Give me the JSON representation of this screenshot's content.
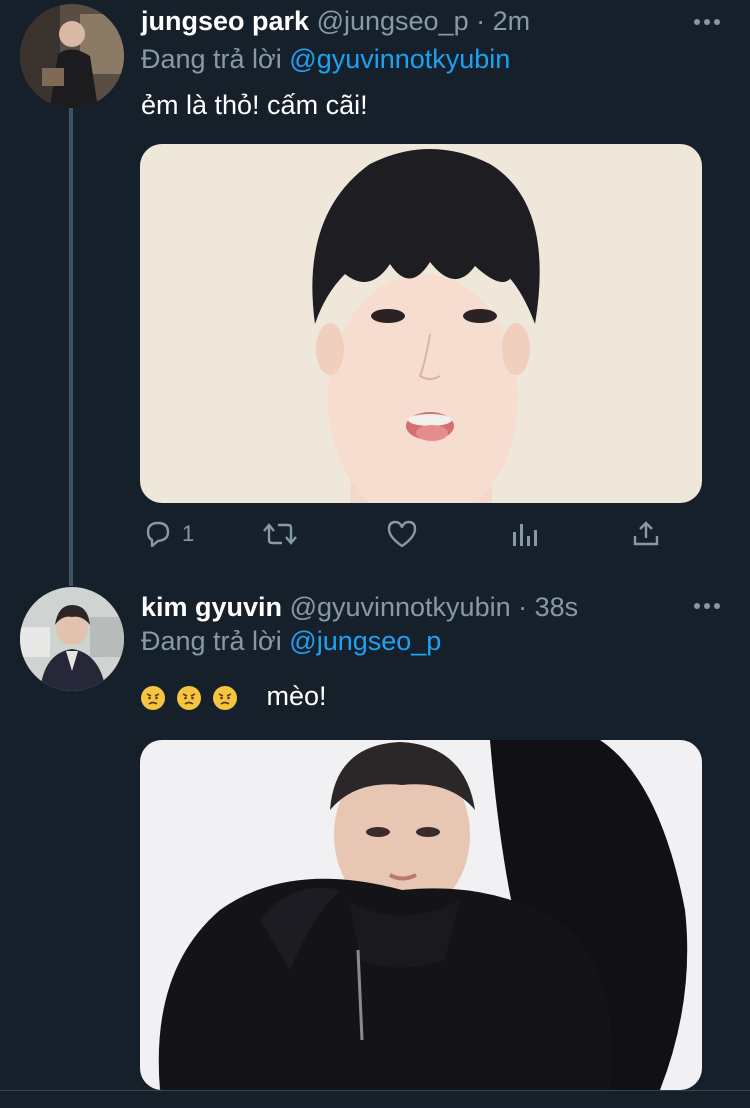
{
  "tweets": [
    {
      "name": "jungseo park",
      "handle": "@jungseo_p",
      "dot": "·",
      "time": "2m",
      "reply_prefix": "Đang trả lời",
      "reply_to": "@gyuvinnotkyubin",
      "text": "ẻm là thỏ! cấm cãi!",
      "reply_count": "1",
      "icons": [
        "reply-icon",
        "retweet-icon",
        "like-icon",
        "analytics-icon",
        "share-icon"
      ]
    },
    {
      "name": "kim gyuvin",
      "handle": "@gyuvinnotkyubin",
      "dot": "·",
      "time": "38s",
      "reply_prefix": "Đang trả lời",
      "reply_to": "@jungseo_p",
      "emoji_icons": [
        "angry-face-emoji",
        "angry-face-emoji",
        "angry-face-emoji"
      ],
      "text": "mèo!"
    }
  ],
  "colors": {
    "background": "#15202b",
    "secondary_text": "#8899a6",
    "link": "#1da1f2",
    "thread_line": "#3d5466"
  }
}
